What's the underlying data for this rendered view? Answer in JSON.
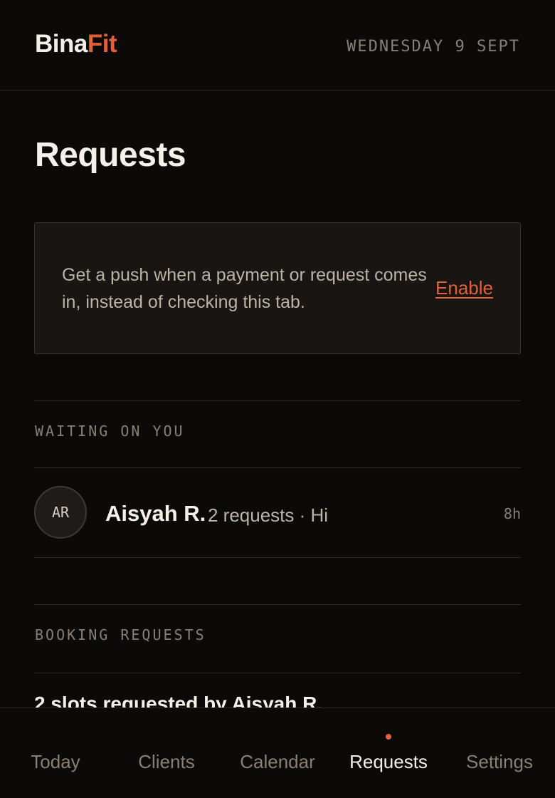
{
  "header": {
    "logo_part1": "Bina",
    "logo_part2": "Fit",
    "date": "WEDNESDAY 9 SEPT"
  },
  "page": {
    "title": "Requests"
  },
  "notice": {
    "text": "Get a push when a payment or request comes in, instead of checking this tab.",
    "action_label": "Enable"
  },
  "waiting": {
    "label": "WAITING ON YOU",
    "items": [
      {
        "initials": "AR",
        "name": "Aisyah R.",
        "detail": "2 requests · Hi",
        "time": "8h"
      }
    ]
  },
  "booking": {
    "label": "BOOKING REQUESTS",
    "first_item_title": "2 slots requested by Aisyah R."
  },
  "tabs": [
    {
      "label": "Today",
      "active": false
    },
    {
      "label": "Clients",
      "active": false
    },
    {
      "label": "Calendar",
      "active": false
    },
    {
      "label": "Requests",
      "active": true
    },
    {
      "label": "Settings",
      "active": false
    }
  ],
  "colors": {
    "background": "#0c0a09",
    "accent": "#e0623a",
    "text": "#f5f1ea",
    "muted": "#8a7f73"
  }
}
